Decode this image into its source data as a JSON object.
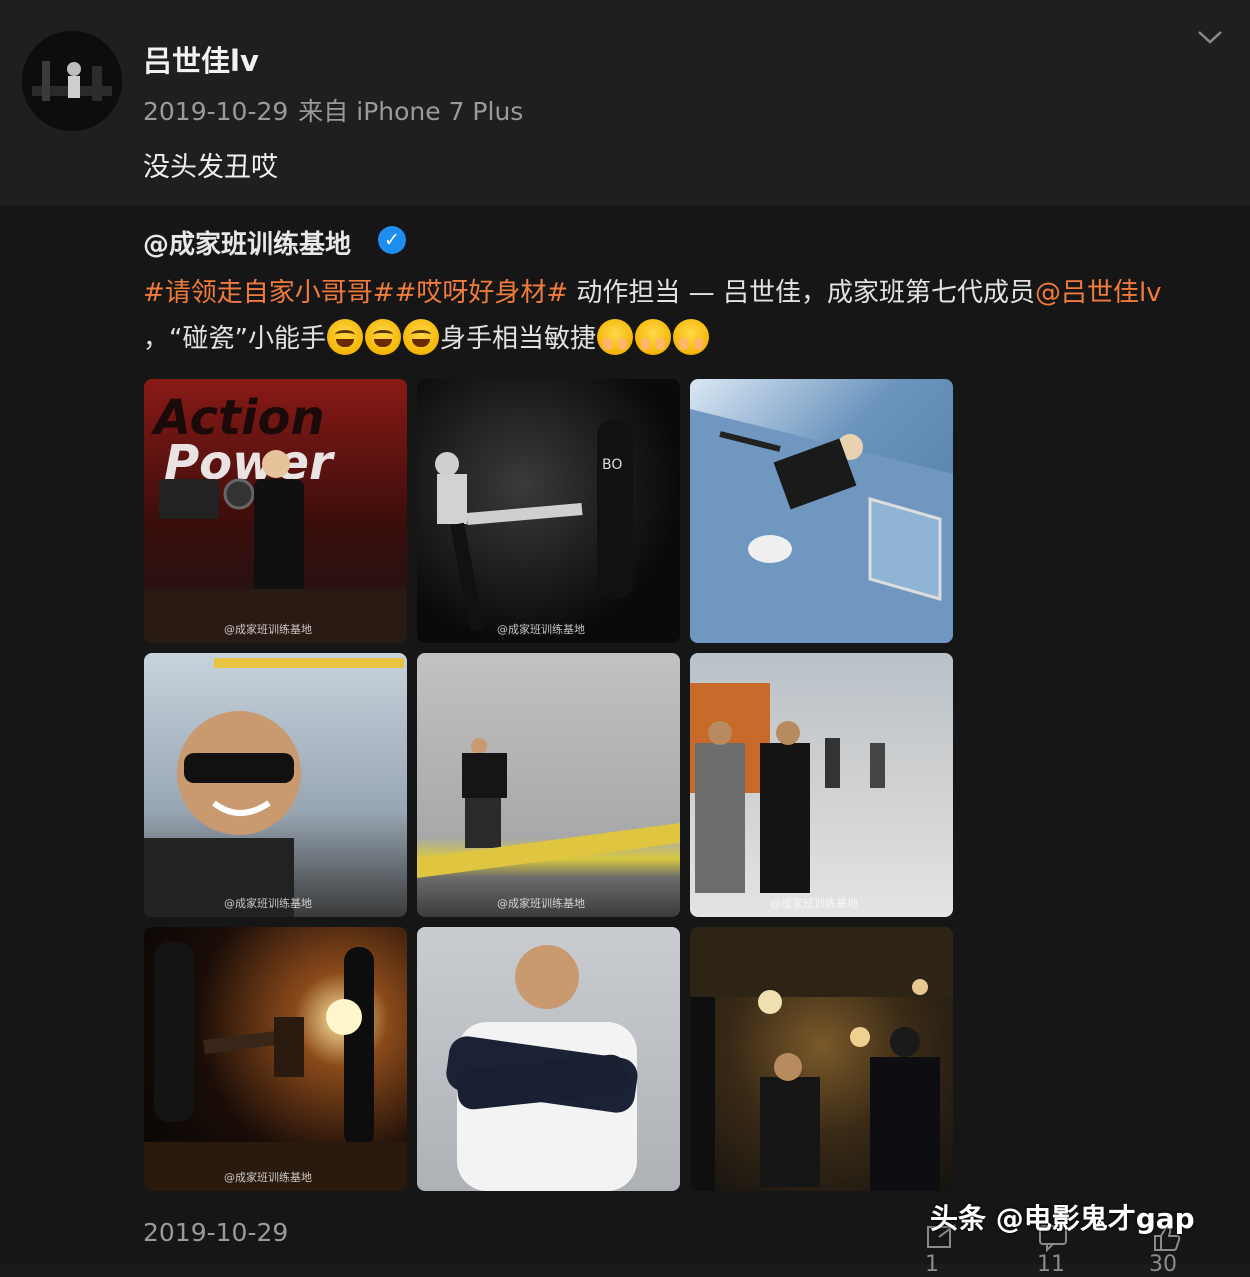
{
  "post": {
    "username": "吕世佳lv",
    "date": "2019-10-29",
    "source": "来自 iPhone 7 Plus",
    "text": "没头发丑哎"
  },
  "repost": {
    "author": "@成家班训练基地",
    "verified_icon": "verified-check-icon",
    "hashtag1": "#请领走自家小哥哥#",
    "hashtag2": "#哎呀好身材#",
    "text_part1": " 动作担当 — 吕世佳，成家班第七代成员",
    "mention": "@吕世佳lv",
    "text_part2": "，“碰瓷”小能手",
    "text_part3": "身手相当敏捷",
    "emojis_laugh": [
      "laugh-cry-emoji",
      "laugh-cry-emoji",
      "laugh-cry-emoji"
    ],
    "emojis_shy": [
      "shy-emoji",
      "shy-emoji",
      "shy-emoji"
    ],
    "photos": [
      {
        "name": "photo-camera-rig"
      },
      {
        "name": "photo-kick-punching-bag"
      },
      {
        "name": "photo-wire-stunt"
      },
      {
        "name": "photo-sunglasses-portrait"
      },
      {
        "name": "photo-rooftop-ledge"
      },
      {
        "name": "photo-set-crew"
      },
      {
        "name": "photo-kick-backlit"
      },
      {
        "name": "photo-studio-portrait"
      },
      {
        "name": "photo-film-set-interior"
      }
    ]
  },
  "footer": {
    "date": "2019-10-29",
    "repost_count": "1",
    "comment_count": "11",
    "like_count": "30"
  },
  "watermark": {
    "credit": "头条 @电影鬼才gap"
  },
  "colors": {
    "accent_orange": "#ef7b3c",
    "verified_blue": "#1d8ef0"
  }
}
